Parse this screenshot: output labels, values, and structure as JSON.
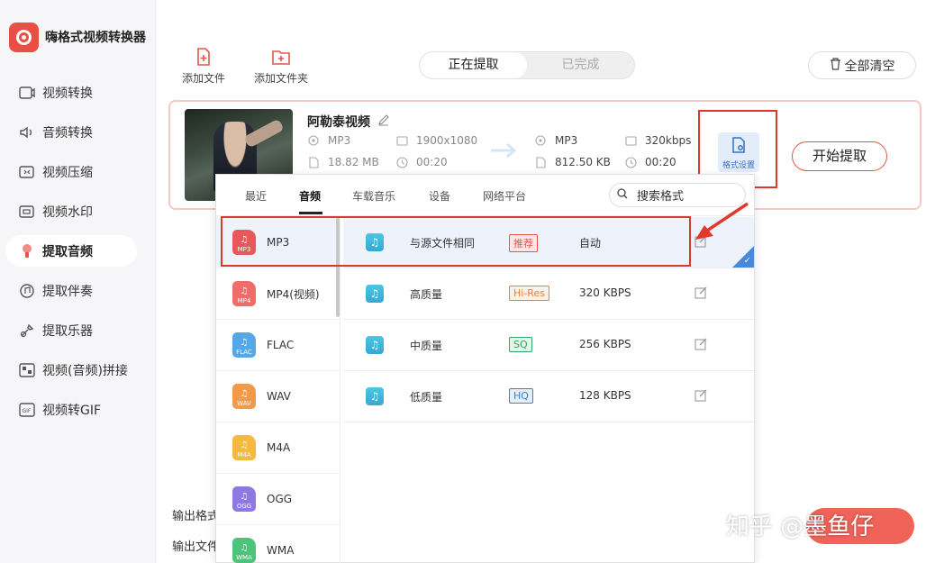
{
  "app": {
    "title": "嗨格式视频转换器",
    "brand_color": "#ea4f45"
  },
  "sidebar": {
    "items": [
      {
        "label": "视频转换",
        "icon": "video-convert-icon",
        "active": false
      },
      {
        "label": "音频转换",
        "icon": "audio-convert-icon",
        "active": false
      },
      {
        "label": "视频压缩",
        "icon": "video-compress-icon",
        "active": false
      },
      {
        "label": "视频水印",
        "icon": "video-watermark-icon",
        "active": false
      },
      {
        "label": "提取音频",
        "icon": "extract-audio-icon",
        "active": true
      },
      {
        "label": "提取伴奏",
        "icon": "extract-accompaniment-icon",
        "active": false
      },
      {
        "label": "提取乐器",
        "icon": "extract-instrument-icon",
        "active": false
      },
      {
        "label": "视频(音频)拼接",
        "icon": "merge-icon",
        "active": false
      },
      {
        "label": "视频转GIF",
        "icon": "gif-icon",
        "active": false
      }
    ]
  },
  "toolbar": {
    "add_file": "添加文件",
    "add_folder": "添加文件夹",
    "seg_active": "正在提取",
    "seg_done": "已完成",
    "clear_all": "全部清空"
  },
  "file": {
    "name": "阿勒泰视频",
    "src_format": "MP3",
    "src_resolution": "1900x1080",
    "src_size": "18.82 MB",
    "src_duration": "00:20",
    "dst_format": "MP3",
    "dst_bitrate": "320kbps",
    "dst_size": "812.50 KB",
    "dst_duration": "00:20",
    "format_settings": "格式设置",
    "start": "开始提取"
  },
  "footer": {
    "output_format_label": "输出格式",
    "output_folder_label": "输出文件"
  },
  "popup": {
    "tabs": [
      "最近",
      "音频",
      "车载音乐",
      "设备",
      "网络平台"
    ],
    "active_tab": 1,
    "search_placeholder": "搜索格式",
    "formats": [
      {
        "name": "MP3",
        "tag": "MP3",
        "color": "#e8585a",
        "active": true
      },
      {
        "name": "MP4(视频)",
        "tag": "MP4",
        "color": "#ee6c6a",
        "active": false
      },
      {
        "name": "FLAC",
        "tag": "FLAC",
        "color": "#56a7e6",
        "active": false
      },
      {
        "name": "WAV",
        "tag": "WAV",
        "color": "#f19a4b",
        "active": false
      },
      {
        "name": "M4A",
        "tag": "M4A",
        "color": "#f5b942",
        "active": false
      },
      {
        "name": "OGG",
        "tag": "OGG",
        "color": "#8d79e0",
        "active": false
      },
      {
        "name": "WMA",
        "tag": "WMA",
        "color": "#4fc37a",
        "active": false
      }
    ],
    "qualities": [
      {
        "name": "与源文件相同",
        "badge": "推荐",
        "badge_color": "#e5534b",
        "badge_bg": "#fde7e6",
        "value": "自动",
        "selected": true
      },
      {
        "name": "高质量",
        "badge": "Hi-Res",
        "badge_color": "#e8813a",
        "badge_bg": "#fdf0e4",
        "value": "320 KBPS",
        "selected": false
      },
      {
        "name": "中质量",
        "badge": "SQ",
        "badge_color": "#2ea860",
        "badge_bg": "#e4f6ea",
        "value": "256 KBPS",
        "selected": false
      },
      {
        "name": "低质量",
        "badge": "HQ",
        "badge_color": "#3b7fd4",
        "badge_bg": "#e5eefb",
        "value": "128 KBPS",
        "selected": false
      }
    ]
  },
  "watermark": "知乎 @墨鱼仔"
}
